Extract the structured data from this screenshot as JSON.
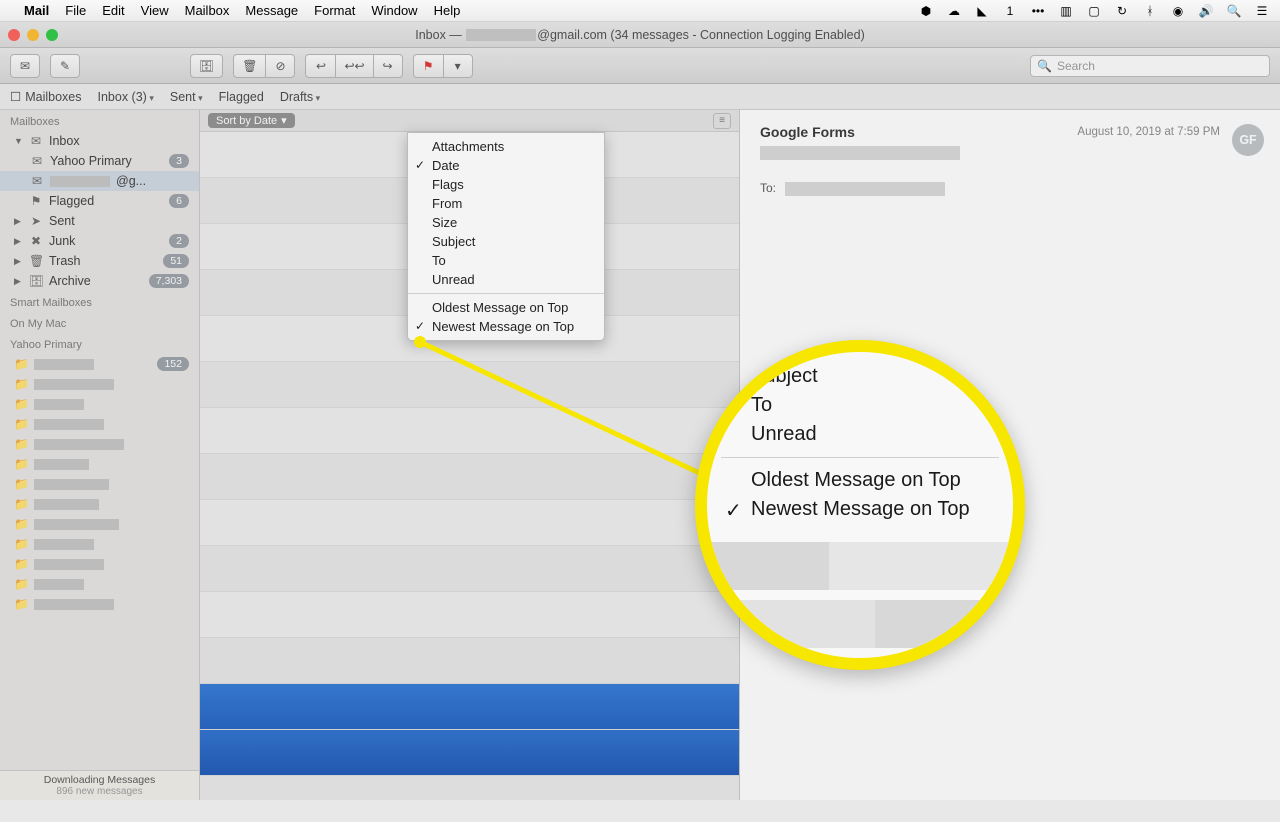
{
  "menubar": {
    "app": "Mail",
    "items": [
      "File",
      "Edit",
      "View",
      "Mailbox",
      "Message",
      "Format",
      "Window",
      "Help"
    ],
    "status_text": "1"
  },
  "window": {
    "title_prefix": "Inbox — ",
    "title_suffix": "@gmail.com (34 messages - Connection Logging Enabled)"
  },
  "favbar": {
    "mailboxes": "Mailboxes",
    "inbox": "Inbox (3)",
    "sent": "Sent",
    "flagged": "Flagged",
    "drafts": "Drafts"
  },
  "sidebar": {
    "header_mailboxes": "Mailboxes",
    "inbox": "Inbox",
    "yahoo_primary": "Yahoo Primary",
    "yahoo_badge": "3",
    "gmail_suffix": "@g...",
    "flagged": "Flagged",
    "flagged_badge": "6",
    "sent": "Sent",
    "junk": "Junk",
    "junk_badge": "2",
    "trash": "Trash",
    "trash_badge": "51",
    "archive": "Archive",
    "archive_badge": "7,303",
    "header_smart": "Smart Mailboxes",
    "header_onmymac": "On My Mac",
    "header_yahoo": "Yahoo Primary",
    "yahoo_folder_badge": "152",
    "status_main": "Downloading Messages",
    "status_sub": "896 new messages"
  },
  "sort": {
    "button": "Sort by Date",
    "items": [
      "Attachments",
      "Date",
      "Flags",
      "From",
      "Size",
      "Subject",
      "To",
      "Unread"
    ],
    "checked": "Date",
    "order_items": [
      "Oldest Message on Top",
      "Newest Message on Top"
    ],
    "order_checked": "Newest Message on Top"
  },
  "preview": {
    "sender": "Google Forms",
    "date": "August 10, 2019 at 7:59 PM",
    "avatar": "GF",
    "to_label": "To:"
  },
  "zoom": {
    "lines": [
      "Subject",
      "To",
      "Unread"
    ],
    "order": [
      "Oldest Message on Top",
      "Newest Message on Top"
    ],
    "order_checked": "Newest Message on Top"
  },
  "search_placeholder": "Search"
}
